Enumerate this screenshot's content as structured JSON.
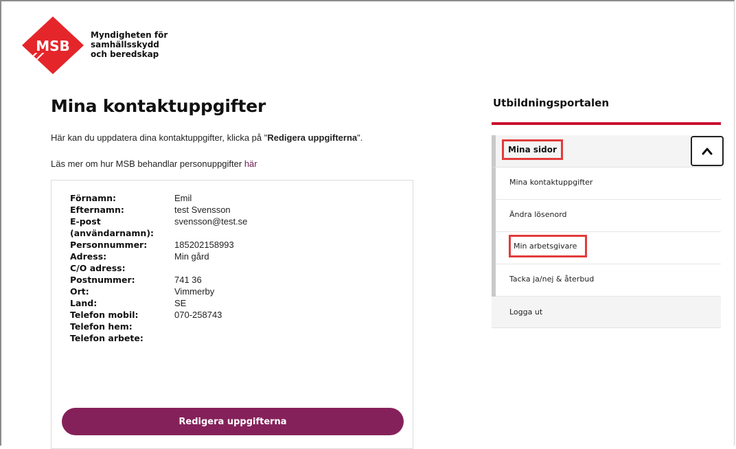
{
  "logo": {
    "badge_text": "MSB",
    "line1": "Myndigheten för",
    "line2": "samhällsskydd",
    "line3": "och beredskap",
    "brand_color": "#e4262b"
  },
  "page": {
    "title": "Mina kontaktuppgifter",
    "intro_prefix": "Här kan du uppdatera dina kontaktuppgifter, klicka på \"",
    "intro_bold": "Redigera uppgifterna",
    "intro_suffix": "\".",
    "more_prefix": "Läs mer om hur MSB behandlar personuppgifter ",
    "more_link": "här"
  },
  "contact": {
    "fields": [
      {
        "label": "Förnamn:",
        "value": "Emil"
      },
      {
        "label": "Efternamn:",
        "value": "test Svensson"
      },
      {
        "label": "E-post",
        "value": "svensson@test.se"
      },
      {
        "label": "(användarnamn):",
        "value": ""
      },
      {
        "label": "Personnummer:",
        "value": "185202158993"
      },
      {
        "label": "Adress:",
        "value": "Min gård"
      },
      {
        "label": "C/O adress:",
        "value": ""
      },
      {
        "label": "Postnummer:",
        "value": "741 36"
      },
      {
        "label": "Ort:",
        "value": "Vimmerby"
      },
      {
        "label": "Land:",
        "value": "SE"
      },
      {
        "label": "Telefon mobil:",
        "value": "070-258743"
      },
      {
        "label": "Telefon hem:",
        "value": ""
      },
      {
        "label": "Telefon arbete:",
        "value": ""
      }
    ],
    "edit_button": "Redigera uppgifterna",
    "button_color": "#85215a"
  },
  "sidebar": {
    "title": "Utbildningsportalen",
    "accent_color": "#c8102e",
    "section_label": "Mina sidor",
    "toggle_icon": "chevron-up-icon",
    "items": [
      {
        "label": "Mina kontaktuppgifter"
      },
      {
        "label": "Ändra lösenord"
      },
      {
        "label": "Min arbetsgivare"
      },
      {
        "label": "Tacka ja/nej & återbud"
      }
    ],
    "logout_label": "Logga ut"
  }
}
